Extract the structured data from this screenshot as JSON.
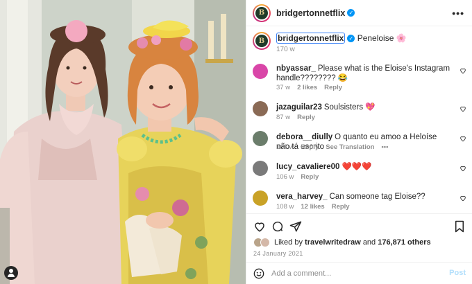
{
  "post": {
    "username": "bridgertonnetflix",
    "avatar_letter": "B",
    "caption": "Peneloise 🌸",
    "caption_age": "170 w"
  },
  "header": {
    "username": "bridgertonnetflix",
    "more_label": "•••"
  },
  "comments": [
    {
      "username": "nbyassar_",
      "text": "Please what is the Eloise's Instagram handle???????? 😂",
      "age": "37 w",
      "likes": "2 likes",
      "reply": "Reply",
      "avatar_color": "#d946a8"
    },
    {
      "username": "jazaguilar23",
      "text": "Soulsisters 💖",
      "age": "87 w",
      "likes": "",
      "reply": "Reply",
      "avatar_color": "#8a6a55"
    },
    {
      "username": "debora__diully",
      "text": "O quanto eu amoo a Heloíse não tá escrito",
      "age": "103 w",
      "likes": "",
      "reply": "Reply",
      "translation": "See Translation",
      "more": "•••",
      "avatar_color": "#6b7d6b"
    },
    {
      "username": "lucy_cavaliere00",
      "text": "❤️❤️❤️",
      "age": "106 w",
      "likes": "",
      "reply": "Reply",
      "avatar_color": "#7a7a7a"
    },
    {
      "username": "vera_harvey_",
      "text": "Can someone tag Eloise??",
      "age": "108 w",
      "likes": "12 likes",
      "reply": "Reply",
      "avatar_color": "#c9a227"
    }
  ],
  "likes": {
    "prefix": "Liked by",
    "first_liker": "travelwritedraw",
    "and": "and",
    "others": "176,871 others"
  },
  "date": "24 January 2021",
  "add_comment": {
    "placeholder": "Add a comment...",
    "post_label": "Post"
  },
  "icons": [
    "heart-icon",
    "comment-icon",
    "share-icon",
    "bookmark-icon",
    "emoji-icon",
    "more-icon",
    "verified-icon",
    "user-tag-icon"
  ],
  "colors": {
    "accent": "#0095f6",
    "muted": "#8e8e8e",
    "text": "#262626",
    "post_disabled": "#b2dffc"
  }
}
